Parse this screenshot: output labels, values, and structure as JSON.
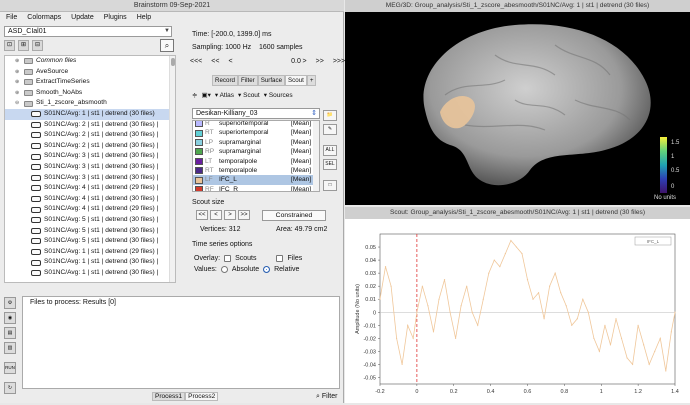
{
  "left_window": {
    "title": "Brainstorm 09-Sep-2021",
    "menus": [
      "File",
      "Colormaps",
      "Update",
      "Plugins",
      "Help"
    ],
    "protocol": "ASD_CIal01",
    "tree": [
      {
        "label": "Common files",
        "type": "folder",
        "indent": 1,
        "italic": true
      },
      {
        "label": "AveSource",
        "type": "folder",
        "indent": 1
      },
      {
        "label": "ExtractTimeSeries",
        "type": "folder",
        "indent": 1
      },
      {
        "label": "Smooth_NoAbs",
        "type": "folder",
        "indent": 1
      },
      {
        "label": "Sti_1_zscore_absmooth",
        "type": "folder",
        "indent": 1
      },
      {
        "label": "S01NC/Avg: 1 | st1 | detrend (30 files)",
        "type": "item",
        "selected": true
      },
      {
        "label": "S01NC/Avg: 2 | st1 | detrend (30 files) |",
        "type": "item"
      },
      {
        "label": "S01NC/Avg: 2 | st1 | detrend (30 files) |",
        "type": "item"
      },
      {
        "label": "S01NC/Avg: 2 | st1 | detrend (30 files) |",
        "type": "item"
      },
      {
        "label": "S01NC/Avg: 3 | st1 | detrend (30 files) |",
        "type": "item"
      },
      {
        "label": "S01NC/Avg: 3 | st1 | detrend (30 files) |",
        "type": "item"
      },
      {
        "label": "S01NC/Avg: 3 | st1 | detrend (30 files) |",
        "type": "item"
      },
      {
        "label": "S01NC/Avg: 4 | st1 | detrend (29 files) |",
        "type": "item"
      },
      {
        "label": "S01NC/Avg: 4 | st1 | detrend (30 files) |",
        "type": "item"
      },
      {
        "label": "S01NC/Avg: 4 | st1 | detrend (29 files) |",
        "type": "item"
      },
      {
        "label": "S01NC/Avg: 5 | st1 | detrend (30 files) |",
        "type": "item"
      },
      {
        "label": "S01NC/Avg: 5 | st1 | detrend (30 files) |",
        "type": "item"
      },
      {
        "label": "S01NC/Avg: 5 | st1 | detrend (30 files) |",
        "type": "item"
      },
      {
        "label": "S01NC/Avg: 1 | st1 | detrend (29 files) |",
        "type": "item"
      },
      {
        "label": "S01NC/Avg: 1 | st1 | detrend (30 files) |",
        "type": "item"
      },
      {
        "label": "S01NC/Avg: 1 | st1 | detrend (30 files) |",
        "type": "item"
      }
    ],
    "time": {
      "label": "Time:",
      "value": "[-200.0, 1399.0] ms"
    },
    "sampling": {
      "label": "Sampling: 1000 Hz",
      "samples": "1600 samples"
    },
    "nav": {
      "b3": "<<<",
      "b2": "<<",
      "b1": "<",
      "current": "0.0",
      "f1": ">",
      "f2": ">>",
      "f3": ">>>"
    },
    "tabs": [
      "Record",
      "Filter",
      "Surface",
      "Scout",
      "+"
    ],
    "scout_tools": {
      "atlas": "Atlas",
      "scout": "Scout",
      "sources": "Sources"
    },
    "atlas_name": "Desikan-Killiany_03",
    "scouts": [
      {
        "prefix": "R",
        "name": "superiortemporal",
        "func": "[Mean]",
        "color": "#b8b8ff"
      },
      {
        "prefix": "RT",
        "name": "superiortemporal",
        "func": "[Mean]",
        "color": "#61d0d6"
      },
      {
        "prefix": "LP",
        "name": "supramarginal",
        "func": "[Mean]",
        "color": "#8ad0e0"
      },
      {
        "prefix": "RP",
        "name": "supramarginal",
        "func": "[Mean]",
        "color": "#4fa74f"
      },
      {
        "prefix": "LT",
        "name": "temporalpole",
        "func": "[Mean]",
        "color": "#6a1fa0"
      },
      {
        "prefix": "RT",
        "name": "temporalpole",
        "func": "[Mean]",
        "color": "#4b2b88"
      },
      {
        "prefix": "LF",
        "name": "IFC_L",
        "func": "[Mean]",
        "color": "#e9c49a",
        "selected": true
      },
      {
        "prefix": "RF",
        "name": "IFC_R",
        "func": "[Mean]",
        "color": "#d33b2d"
      }
    ],
    "scout_side_buttons": [
      "ALL",
      "SEL"
    ],
    "scout_size": {
      "label": "Scout size",
      "buttons": [
        "<<",
        "<",
        ">",
        ">>"
      ],
      "mode": "Constrained",
      "vertices": "Vertices: 312",
      "area": "Area: 49.79 cm2"
    },
    "ts_options": {
      "label": "Time series options",
      "overlay_label": "Overlay:",
      "overlay_opts": [
        "Scouts",
        "Files"
      ],
      "values_label": "Values:",
      "values_opts": [
        "Absolute",
        "Relative"
      ],
      "values_selected": "Relative"
    },
    "files_box": {
      "title": "Files to process: Results [0]"
    },
    "bottom_tabs": [
      "Process1",
      "Process2"
    ],
    "filter_label": "Filter",
    "run_label": "RUN"
  },
  "mri_window": {
    "title": "MEG/3D: Group_analysis/Sti_1_zscore_abesmooth/S01NC/Avg: 1 | st1 | detrend (30 files)",
    "colorbar": {
      "ticks": [
        "1.5",
        "1",
        "0.5",
        "0"
      ],
      "unit_label": "No units"
    }
  },
  "ts_window": {
    "title": "Scout: Group_analysis/Sti_1_zscore_abesmooth/S01NC/Avg: 1 | st1 | detrend (30 files)",
    "legend": "IFC_L"
  },
  "chart_data": {
    "type": "line",
    "ylabel": "Amplitude (No units)",
    "xlabel": "",
    "xlim": [
      -0.2,
      1.4
    ],
    "ylim": [
      -0.055,
      0.06
    ],
    "xticks": [
      "-0.2",
      "0",
      "0.2",
      "0.4",
      "0.6",
      "0.8",
      "1",
      "1.2",
      "1.4"
    ],
    "yticks": [
      "0.05",
      "0.04",
      "0.03",
      "0.02",
      "0.01",
      "0",
      "-0.01",
      "-0.02",
      "-0.03",
      "-0.04",
      "-0.05"
    ],
    "event_line_x": 0,
    "series": [
      {
        "name": "IFC_L",
        "color": "#f0c79a",
        "x": [
          -0.2,
          -0.17,
          -0.14,
          -0.11,
          -0.08,
          -0.05,
          -0.02,
          0.0,
          0.03,
          0.06,
          0.09,
          0.12,
          0.15,
          0.18,
          0.21,
          0.24,
          0.27,
          0.3,
          0.33,
          0.36,
          0.39,
          0.42,
          0.45,
          0.48,
          0.51,
          0.54,
          0.57,
          0.6,
          0.63,
          0.66,
          0.69,
          0.72,
          0.75,
          0.78,
          0.81,
          0.84,
          0.87,
          0.9,
          0.93,
          0.96,
          0.99,
          1.02,
          1.05,
          1.08,
          1.11,
          1.14,
          1.17,
          1.2,
          1.23,
          1.26,
          1.29,
          1.32,
          1.35,
          1.38,
          1.4
        ],
        "values": [
          0.01,
          0.035,
          0.02,
          -0.02,
          -0.04,
          -0.01,
          -0.02,
          0.0,
          0.02,
          0.005,
          -0.015,
          0.01,
          0.025,
          0.0,
          -0.02,
          0.005,
          0.02,
          0.0,
          -0.01,
          0.01,
          0.03,
          0.04,
          0.035,
          0.045,
          0.055,
          0.05,
          0.045,
          0.025,
          0.01,
          0.015,
          -0.005,
          0.02,
          0.03,
          0.015,
          0.005,
          -0.01,
          -0.005,
          0.01,
          0.0,
          -0.02,
          -0.03,
          -0.01,
          -0.025,
          -0.005,
          -0.02,
          -0.035,
          -0.04,
          -0.01,
          -0.025,
          -0.04,
          -0.03,
          -0.02,
          -0.045,
          -0.015,
          0.0
        ]
      }
    ]
  }
}
